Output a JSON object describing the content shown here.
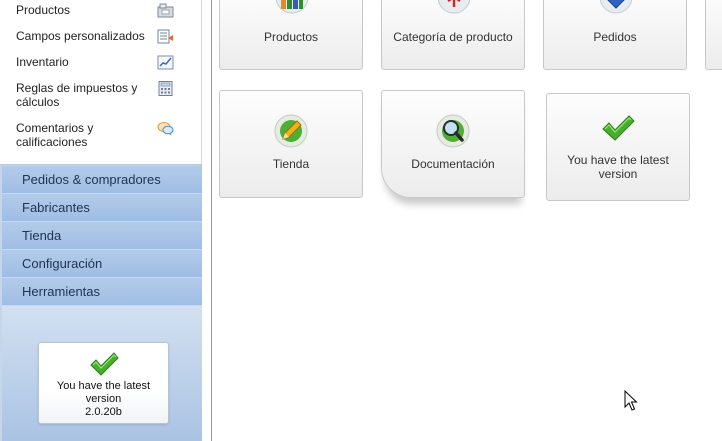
{
  "sidebar": {
    "subitems": [
      {
        "label": "Productos",
        "icon": "folder-icon"
      },
      {
        "label": "Campos personalizados",
        "icon": "fields-icon"
      },
      {
        "label": "Inventario",
        "icon": "chart-icon"
      },
      {
        "label": "Reglas de impuestos y cálculos",
        "icon": "calculator-icon"
      },
      {
        "label": "Comentarios y calificaciones",
        "icon": "comments-icon"
      }
    ],
    "menu": [
      {
        "label": "Pedidos & compradores"
      },
      {
        "label": "Fabricantes"
      },
      {
        "label": "Tienda"
      },
      {
        "label": "Configuración"
      },
      {
        "label": "Herramientas"
      }
    ],
    "version_box": {
      "text": "You have the latest version",
      "version": "2.0.20b"
    }
  },
  "main": {
    "tiles": [
      {
        "label": "Productos",
        "icon": "products-icon"
      },
      {
        "label": "Categoría de producto",
        "icon": "category-icon"
      },
      {
        "label": "Pedidos",
        "icon": "orders-icon"
      },
      {
        "label": "Tienda",
        "icon": "store-edit-icon"
      },
      {
        "label": "Documentación",
        "icon": "documentation-search-icon"
      },
      {
        "label": "You have the latest version",
        "icon": "checkmark-icon"
      }
    ]
  },
  "colors": {
    "menu_bg": "#a9c4e6",
    "sidebar_bg": "#c5d5ea",
    "check_green": "#3a9a1c"
  }
}
